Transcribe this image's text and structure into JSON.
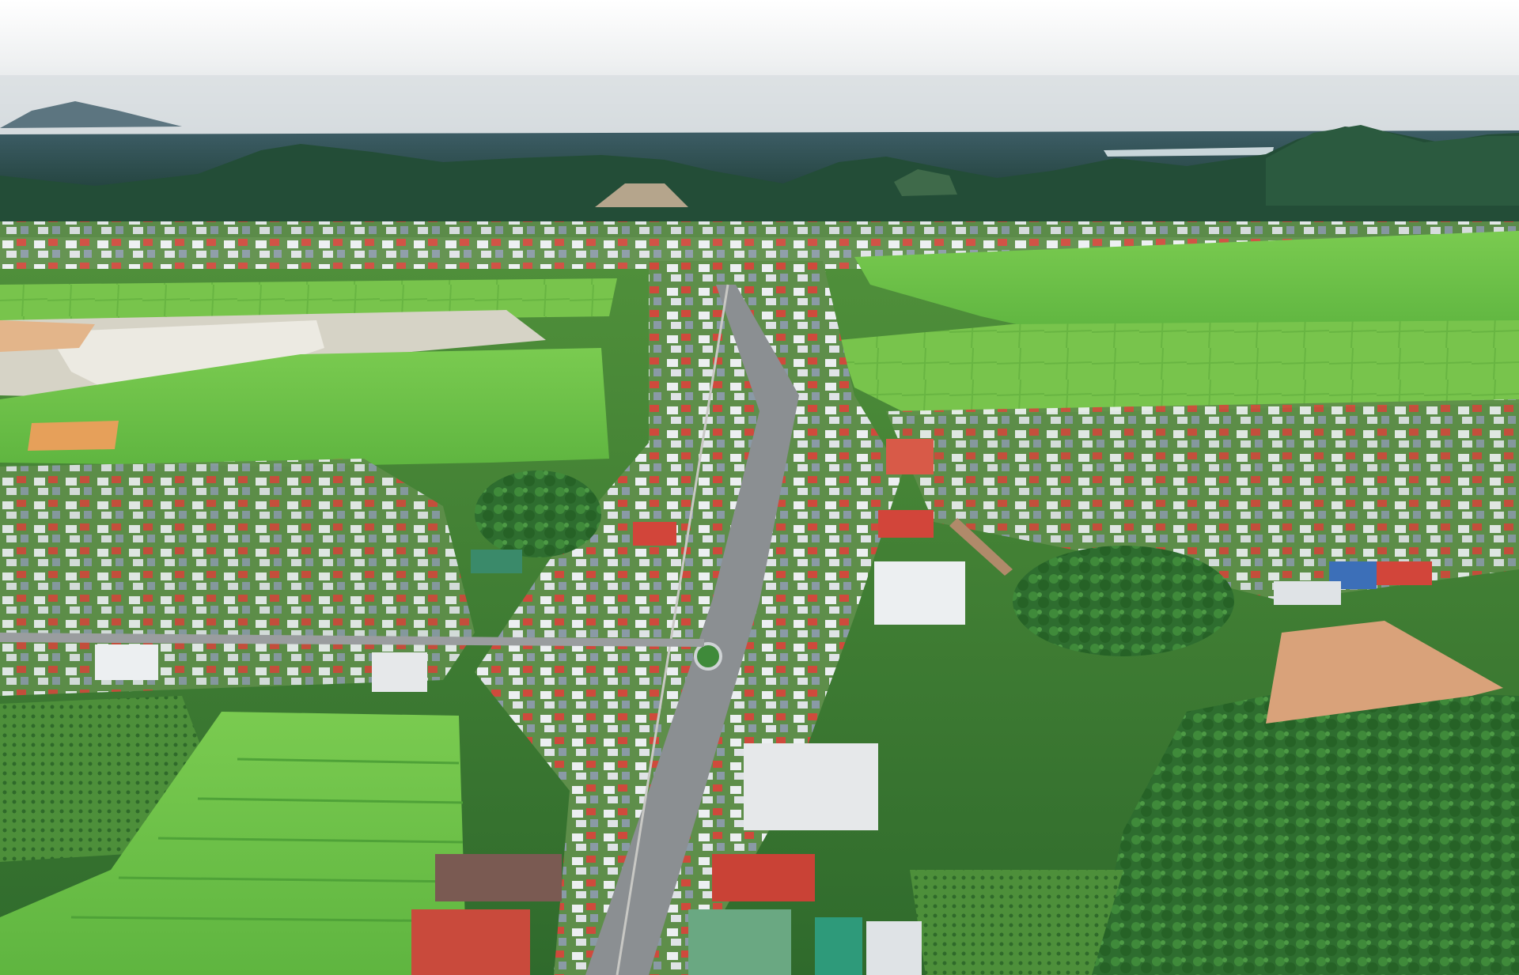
{
  "photo": {
    "subject": "aerial-view-of-small-town",
    "colors": {
      "sky_top": "#ffffff",
      "sky_haze": "#dfe3e6",
      "far_mountain": "#3e5c64",
      "forest_dark": "#1f4a3a",
      "forest_mid": "#2f6b3e",
      "field_bright": "#6cc24a",
      "field_light": "#8fd35a",
      "paddy_pale": "#dcdcd2",
      "road": "#8a8a8a",
      "roof_red": "#d2453a",
      "roof_white": "#eef0f2",
      "roof_blue": "#3c6fb8",
      "tree_canopy": "#2e7a34",
      "bare_soil": "#d9a27a"
    }
  }
}
